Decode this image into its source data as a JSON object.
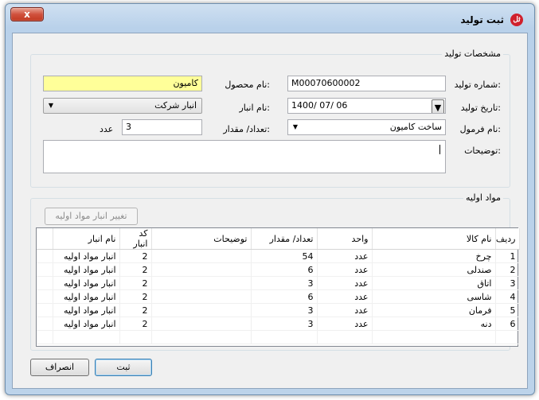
{
  "window": {
    "title": "ثبت تولید",
    "close_label": "x",
    "app_icon_label": "ثل"
  },
  "production": {
    "section_title": "مشخصات تولید",
    "production_number_label": "شماره تولید:",
    "production_number_value": "M00070600002",
    "product_name_label": "نام محصول:",
    "product_name_value": "کامیون",
    "production_date_label": "تاریخ تولید:",
    "production_date_value": "1400/ 07/ 06",
    "warehouse_label": "نام انبار:",
    "warehouse_value": "انبار شرکت",
    "formula_label": "نام فرمول:",
    "formula_value": "ساخت کامیون",
    "quantity_label": "تعداد/ مقدار:",
    "quantity_value": "3",
    "quantity_unit": "عدد",
    "description_label": "توضیحات:",
    "description_value": ""
  },
  "materials": {
    "section_title": "مواد اولیه",
    "change_warehouse_label": "تغییر انبار مواد اولیه",
    "columns": [
      "ردیف",
      "نام کالا",
      "واحد",
      "تعداد/ مقدار",
      "توضیحات",
      "کد انبار",
      "نام انبار"
    ],
    "rows": [
      {
        "index": "1",
        "item": "چرخ",
        "unit": "عدد",
        "qty": "54",
        "desc": "",
        "wh_code": "2",
        "wh_name": "انبار مواد اولیه"
      },
      {
        "index": "2",
        "item": "صندلی",
        "unit": "عدد",
        "qty": "6",
        "desc": "",
        "wh_code": "2",
        "wh_name": "انبار مواد اولیه"
      },
      {
        "index": "3",
        "item": "اتاق",
        "unit": "عدد",
        "qty": "3",
        "desc": "",
        "wh_code": "2",
        "wh_name": "انبار مواد اولیه"
      },
      {
        "index": "4",
        "item": "شاسی",
        "unit": "عدد",
        "qty": "6",
        "desc": "",
        "wh_code": "2",
        "wh_name": "انبار مواد اولیه"
      },
      {
        "index": "5",
        "item": "فرمان",
        "unit": "عدد",
        "qty": "3",
        "desc": "",
        "wh_code": "2",
        "wh_name": "انبار مواد اولیه"
      },
      {
        "index": "6",
        "item": "دنه",
        "unit": "عدد",
        "qty": "3",
        "desc": "",
        "wh_code": "2",
        "wh_name": "انبار مواد اولیه"
      }
    ]
  },
  "actions": {
    "submit_label": "ثبت",
    "cancel_label": "انصراف"
  }
}
